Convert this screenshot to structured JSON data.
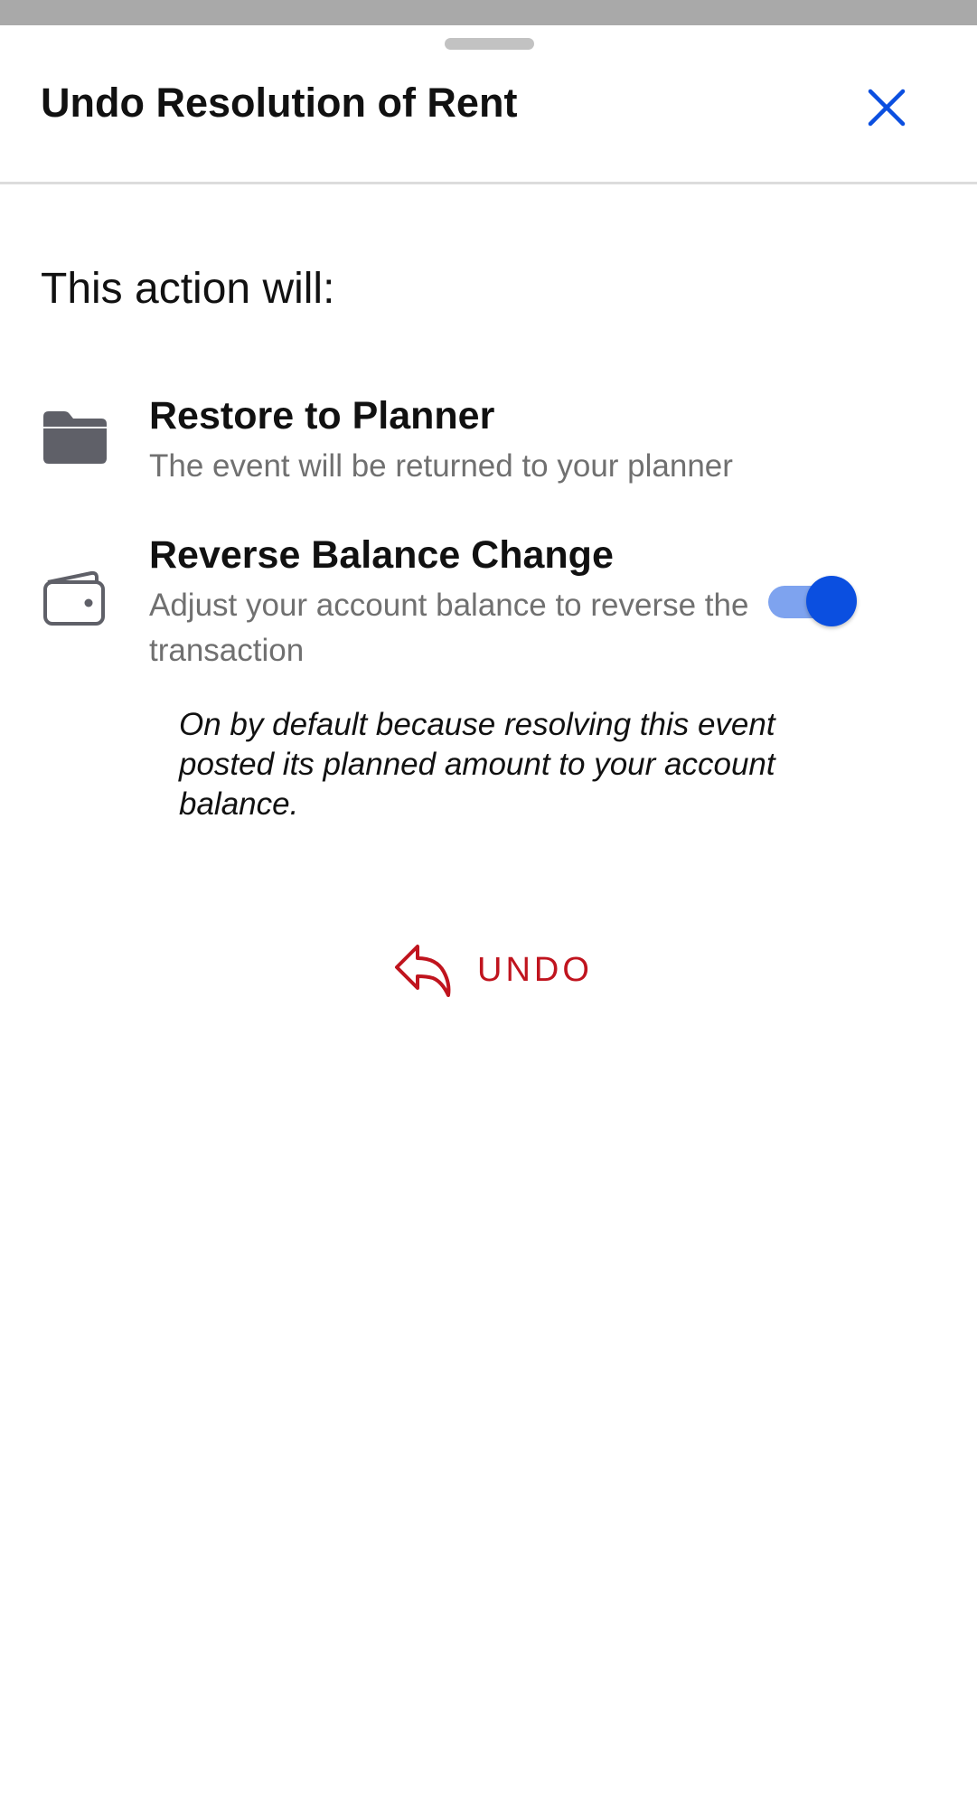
{
  "sheet": {
    "title": "Undo Resolution of Rent",
    "close_icon": "close-icon"
  },
  "body": {
    "heading": "This action will:",
    "items": [
      {
        "icon": "folder-icon",
        "title": "Restore to Planner",
        "subtitle": "The event will be returned to your planner"
      },
      {
        "icon": "wallet-icon",
        "title": "Reverse Balance Change",
        "subtitle": "Adjust your account balance to reverse the transaction",
        "toggle_on": true,
        "note": "On by default because resolving this event posted its planned amount to your account balance."
      }
    ]
  },
  "action": {
    "icon": "undo-arrow-icon",
    "label": "UNDO"
  },
  "colors": {
    "accent": "#0b4fe0",
    "toggle_track": "#7ea3ef",
    "destructive": "#c0141e",
    "icon_gray": "#5f6068",
    "secondary_text": "#707070"
  }
}
